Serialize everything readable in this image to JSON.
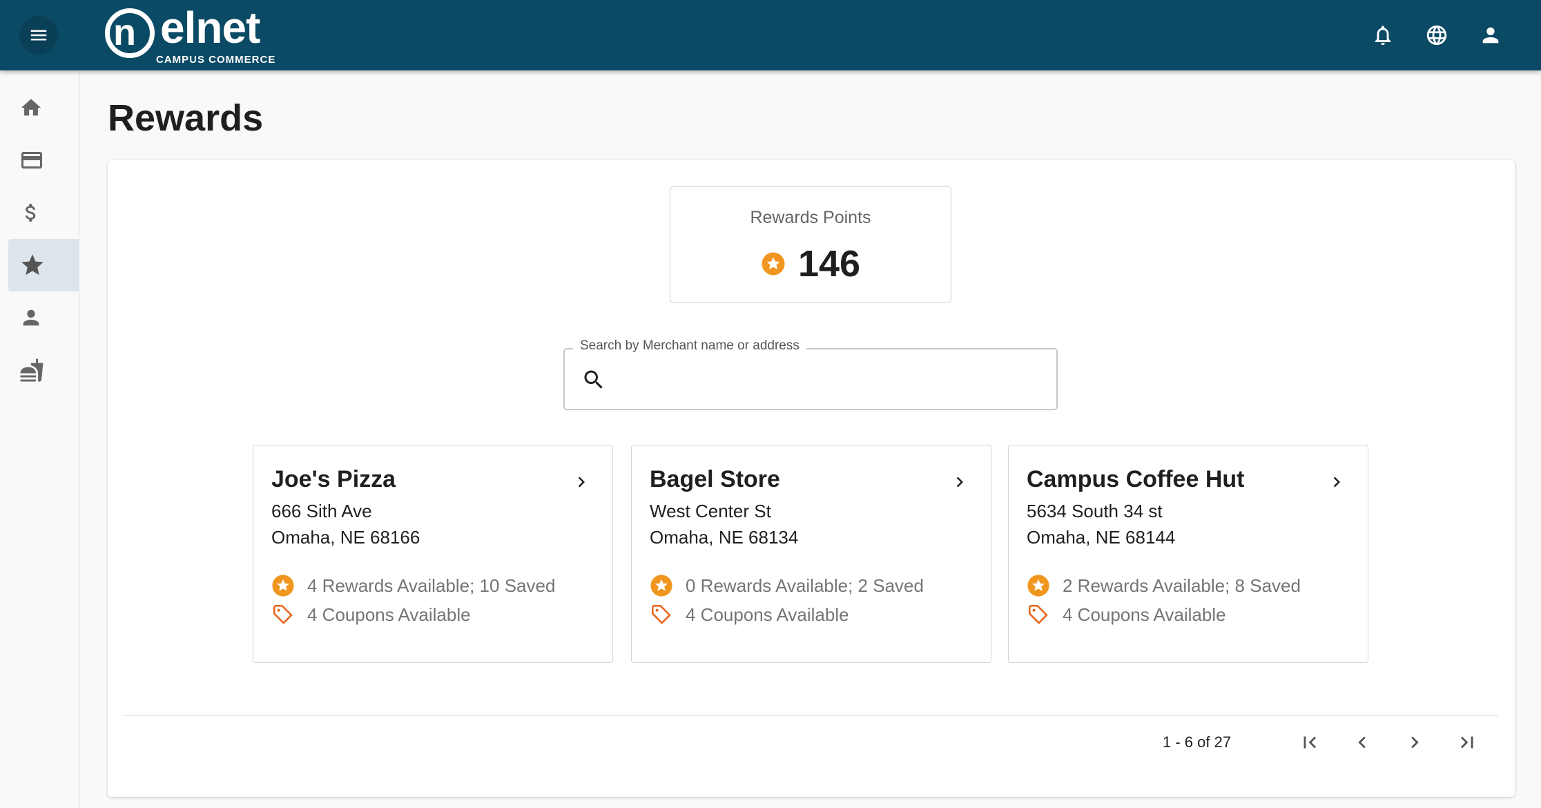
{
  "header": {
    "logo_text": "nelnet",
    "logo_subtitle": "CAMPUS COMMERCE",
    "brand_color": "#0b4a65",
    "icons": [
      "menu-icon",
      "bell-icon",
      "globe-icon",
      "account-icon"
    ]
  },
  "sidebar": {
    "items": [
      {
        "icon": "home-icon"
      },
      {
        "icon": "credit-card-icon"
      },
      {
        "icon": "dollar-icon"
      },
      {
        "icon": "star-icon",
        "active": true
      },
      {
        "icon": "person-icon"
      },
      {
        "icon": "dining-icon"
      }
    ]
  },
  "page": {
    "title": "Rewards"
  },
  "points": {
    "label": "Rewards Points",
    "value": "146",
    "accent_color": "#f0961e"
  },
  "search": {
    "label": "Search by Merchant name or address",
    "value": ""
  },
  "merchants": [
    {
      "name": "Joe's Pizza",
      "address_line1": "666 Sith Ave",
      "address_line2": "Omaha, NE 68166",
      "rewards": "4 Rewards Available; 10 Saved",
      "coupons": "4 Coupons Available"
    },
    {
      "name": "Bagel Store",
      "address_line1": "West Center St",
      "address_line2": "Omaha, NE 68134",
      "rewards": "0 Rewards Available; 2 Saved",
      "coupons": "4 Coupons Available"
    },
    {
      "name": "Campus Coffee Hut",
      "address_line1": "5634 South 34 st",
      "address_line2": "Omaha, NE 68144",
      "rewards": "2 Rewards Available; 8 Saved",
      "coupons": "4 Coupons Available"
    }
  ],
  "pagination": {
    "range_text": "1 - 6 of 27"
  }
}
